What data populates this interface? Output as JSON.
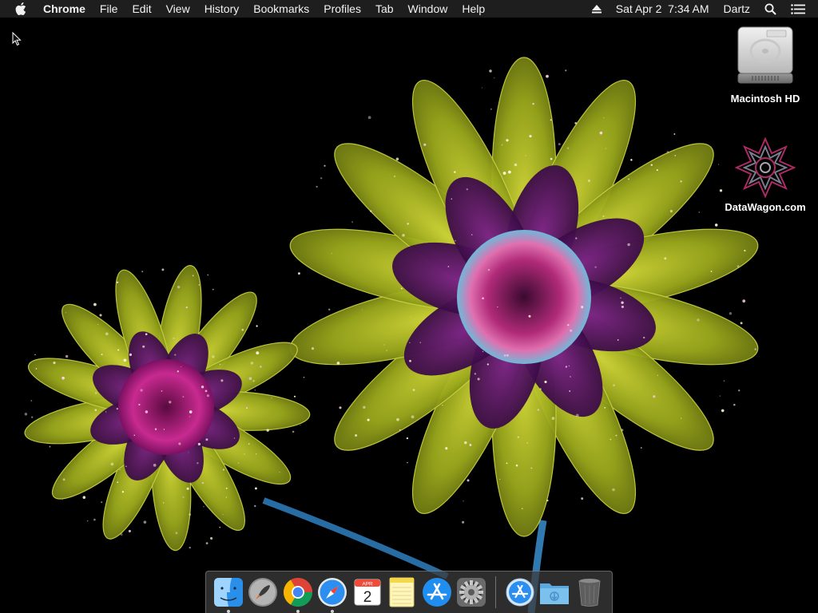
{
  "menubar": {
    "app_name": "Chrome",
    "items": [
      "File",
      "Edit",
      "View",
      "History",
      "Bookmarks",
      "Profiles",
      "Tab",
      "Window",
      "Help"
    ],
    "datetime": "Sat Apr 2  7:34 AM",
    "user": "Dartz",
    "icons": [
      "apple-icon",
      "eject-icon",
      "spotlight-search-icon",
      "notification-center-icon"
    ]
  },
  "desktop": {
    "icons": [
      {
        "label": "Macintosh HD",
        "icon": "hard-drive-icon"
      },
      {
        "label": "DataWagon.com",
        "icon": "star-logo-icon"
      }
    ],
    "wallpaper": "glowing-flowers"
  },
  "dock": {
    "apps": [
      {
        "name": "finder",
        "running": true
      },
      {
        "name": "launchpad",
        "running": false
      },
      {
        "name": "chrome",
        "running": true
      },
      {
        "name": "safari",
        "running": true
      },
      {
        "name": "calendar",
        "running": false,
        "month": "APR",
        "day": "2"
      },
      {
        "name": "notes",
        "running": false
      },
      {
        "name": "app-store",
        "running": false
      },
      {
        "name": "system-preferences",
        "running": false
      }
    ],
    "right": [
      {
        "name": "applications-folder"
      },
      {
        "name": "downloads-folder"
      },
      {
        "name": "trash"
      }
    ]
  },
  "colors": {
    "menubar_bg": "#1e1e1e",
    "petal_yellow": "#a8b41e",
    "petal_purple": "#4a0f5a",
    "center_magenta": "#c0307a",
    "stem_blue": "#3a8fd0"
  }
}
